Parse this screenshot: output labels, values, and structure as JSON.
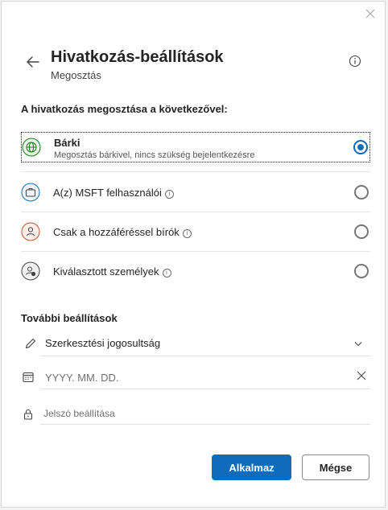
{
  "header": {
    "title": "Hivatkozás-beállítások",
    "subtitle": "Megosztás",
    "back_icon": "arrow-left-icon",
    "info_icon": "info-icon",
    "close_icon": "close-icon"
  },
  "share_section": {
    "heading": "A hivatkozás megosztása a következővel:",
    "options": [
      {
        "label": "Bárki",
        "description": "Megosztás bárkivel, nincs szükség bejelentkezésre",
        "icon": "globe-icon",
        "icon_color": "#107c10",
        "selected": true,
        "has_info": false
      },
      {
        "label": "A(z) MSFT felhasználói",
        "icon": "briefcase-icon",
        "icon_color": "#0f6cbd",
        "selected": false,
        "has_info": true
      },
      {
        "label": "Csak a hozzáféréssel bírók",
        "icon": "person-refresh-icon",
        "icon_color": "#c4542a",
        "selected": false,
        "has_info": true
      },
      {
        "label": "Kiválasztott személyek",
        "icon": "person-lock-icon",
        "icon_color": "#424242",
        "selected": false,
        "has_info": true
      }
    ]
  },
  "more_settings": {
    "heading": "További beállítások",
    "edit_permission": {
      "value": "Szerkesztési jogosultság",
      "icon": "pencil-icon"
    },
    "expiry": {
      "placeholder": "YYYY. MM. DD.",
      "icon": "calendar-icon"
    },
    "password": {
      "placeholder": "Jelszó beállítása",
      "icon": "lock-icon"
    }
  },
  "footer": {
    "apply_label": "Alkalmaz",
    "cancel_label": "Mégse"
  },
  "colors": {
    "accent": "#0f6cbd",
    "globe": "#107c10",
    "briefcase": "#0f6cbd",
    "people": "#c4542a"
  }
}
